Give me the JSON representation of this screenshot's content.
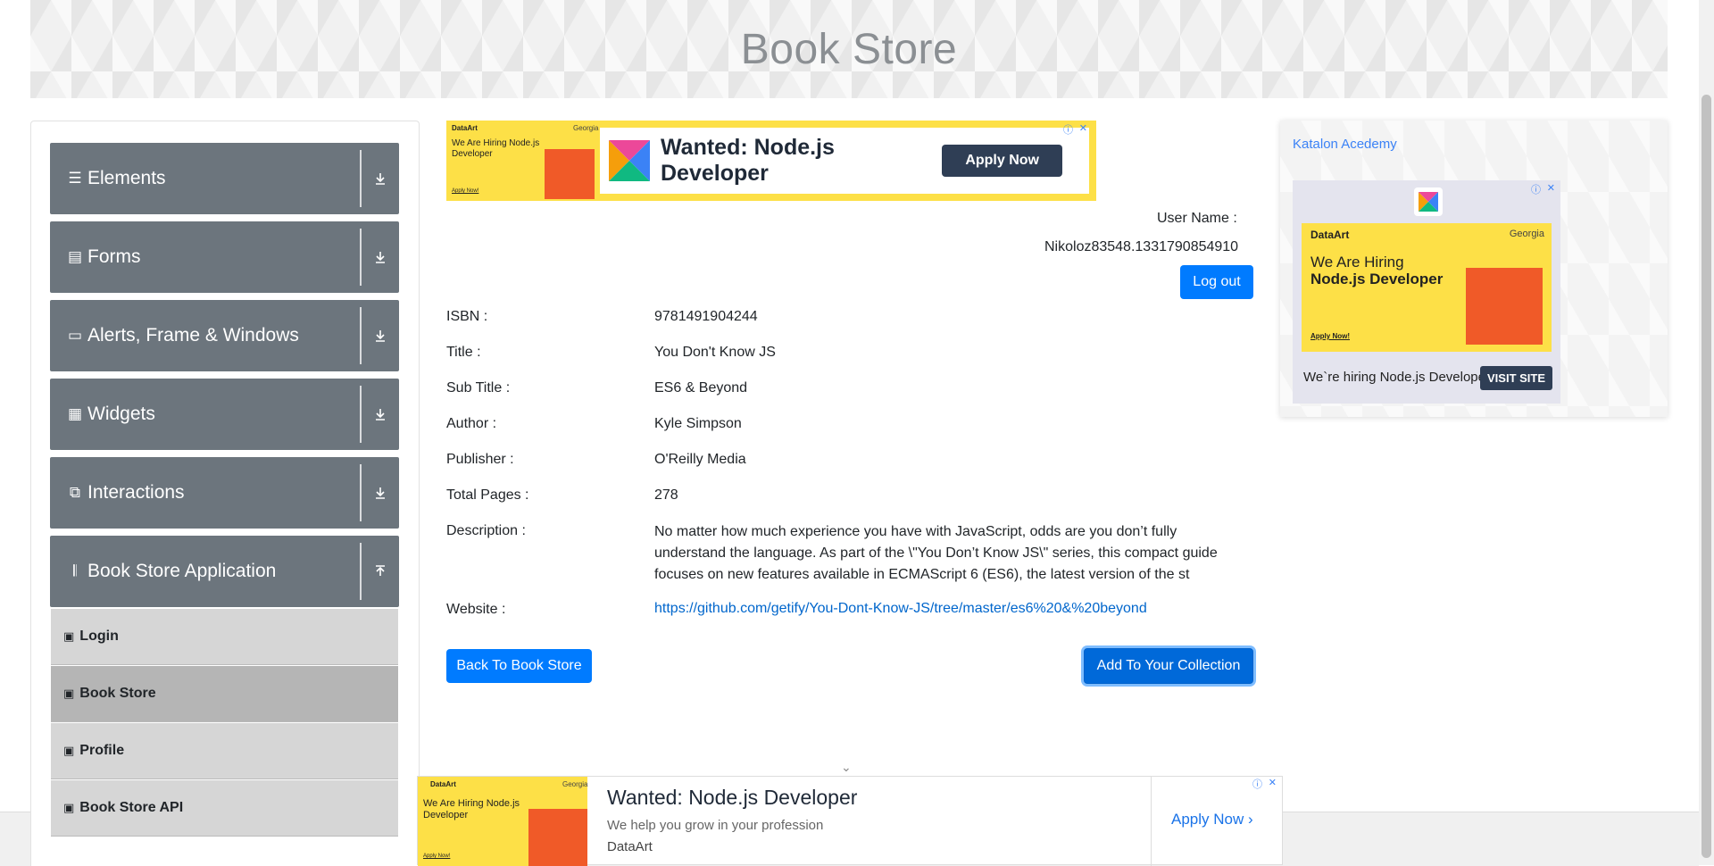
{
  "header": {
    "title": "Book Store"
  },
  "sidebar": {
    "groups": [
      {
        "label": "Elements",
        "icon": "menu-icon",
        "toggle": "chevron-down-icon"
      },
      {
        "label": "Forms",
        "icon": "form-icon",
        "toggle": "chevron-down-icon"
      },
      {
        "label": "Alerts, Frame & Windows",
        "icon": "window-icon",
        "toggle": "chevron-down-icon"
      },
      {
        "label": "Widgets",
        "icon": "widget-icon",
        "toggle": "chevron-down-icon"
      },
      {
        "label": "Interactions",
        "icon": "interaction-icon",
        "toggle": "chevron-down-icon"
      },
      {
        "label": "Book Store Application",
        "icon": "books-icon",
        "toggle": "chevron-up-icon"
      }
    ],
    "items": [
      {
        "label": "Login"
      },
      {
        "label": "Book Store"
      },
      {
        "label": "Profile"
      },
      {
        "label": "Book Store API"
      }
    ]
  },
  "ads": {
    "top": {
      "brand": "DataArt",
      "location": "Georgia",
      "hiring": "We Are Hiring Node.js Developer",
      "apply_small": "Apply Now!",
      "headline": "Wanted: Node.js Developer",
      "button": "Apply Now"
    },
    "right": {
      "link": "Katalon Acedemy",
      "brand": "DataArt",
      "location": "Georgia",
      "hiring_line1": "We Are Hiring",
      "hiring_line2": "Node.js Developer",
      "apply_small": "Apply Now!",
      "text": "We`re hiring Node.js Developer",
      "button": "VISIT SITE"
    },
    "bottom": {
      "brand": "DataArt",
      "location": "Georgia",
      "hiring": "We Are Hiring Node.js Developer",
      "apply_small": "Apply Now!",
      "headline": "Wanted: Node.js Developer",
      "subline": "We help you grow in your profession",
      "company": "DataArt",
      "button": "Apply Now"
    }
  },
  "user": {
    "label": "User Name :",
    "value": "Nikoloz83548.1331790854910",
    "logout": "Log out"
  },
  "book": {
    "isbn_label": "ISBN :",
    "isbn": "9781491904244",
    "title_label": "Title :",
    "title": "You Don't Know JS",
    "subtitle_label": "Sub Title :",
    "subtitle": "ES6 & Beyond",
    "author_label": "Author :",
    "author": "Kyle Simpson",
    "publisher_label": "Publisher :",
    "publisher": "O'Reilly Media",
    "pages_label": "Total Pages :",
    "pages": "278",
    "description_label": "Description :",
    "description": "No matter how much experience you have with JavaScript, odds are you don’t fully understand the language. As part of the \\\"You Don’t Know JS\\\" series, this compact guide focuses on new features available in ECMAScript 6 (ES6), the latest version of the st",
    "website_label": "Website :",
    "website": "https://github.com/getify/You-Dont-Know-JS/tree/master/es6%20&%20beyond"
  },
  "actions": {
    "back": "Back To Book Store",
    "add": "Add To Your Collection"
  }
}
